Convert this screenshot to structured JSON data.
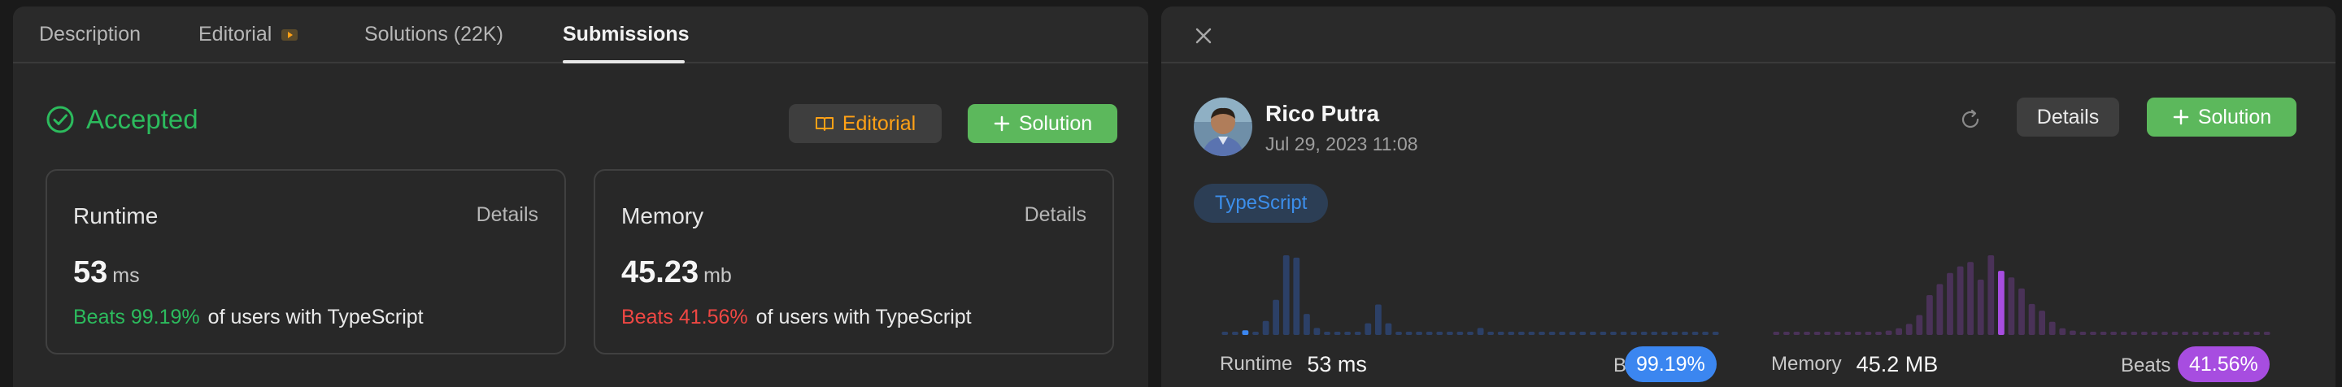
{
  "tabs": [
    {
      "label": "Description",
      "active": false
    },
    {
      "label": "Editorial",
      "active": false
    },
    {
      "label": "Solutions (22K)",
      "active": false
    },
    {
      "label": "Submissions",
      "active": true
    }
  ],
  "result": {
    "status": "Accepted",
    "editorial_button": "Editorial",
    "solution_button": "Solution"
  },
  "runtime_card": {
    "label": "Runtime",
    "details": "Details",
    "value": "53",
    "unit": "ms",
    "beats": "Beats 99.19%",
    "beats_suffix": "of users with TypeScript"
  },
  "memory_card": {
    "label": "Memory",
    "details": "Details",
    "value": "45.23",
    "unit": "mb",
    "beats": "Beats 41.56%",
    "beats_suffix": "of users with TypeScript"
  },
  "submission": {
    "user_name": "Rico Putra",
    "timestamp": "Jul 29, 2023 11:08",
    "details_button": "Details",
    "solution_button": "Solution",
    "language": "TypeScript"
  },
  "runtime_chart": {
    "label": "Runtime",
    "value": "53 ms",
    "beats_label": "Beats",
    "beats": "99.19%",
    "bars": [
      1,
      1,
      2,
      1,
      6,
      15,
      34,
      33,
      9,
      3,
      1,
      1,
      1,
      1,
      5,
      13,
      5,
      1,
      1,
      1,
      1,
      1,
      1,
      1,
      1,
      3,
      1,
      1,
      1,
      1,
      1,
      1,
      1,
      1,
      1,
      1,
      1,
      1,
      1,
      1,
      1,
      1,
      1,
      1,
      1,
      1,
      1,
      1,
      1
    ],
    "highlight_index": 2
  },
  "memory_chart": {
    "label": "Memory",
    "value": "45.2 MB",
    "beats_label": "Beats",
    "beats": "41.56%",
    "bars": [
      1,
      1,
      1,
      1,
      1,
      1,
      1,
      1,
      1,
      1,
      1,
      2,
      3,
      5,
      9,
      18,
      23,
      28,
      31,
      33,
      25,
      36,
      29,
      26,
      21,
      14,
      11,
      6,
      3,
      2,
      1,
      1,
      1,
      1,
      1,
      1,
      1,
      1,
      1,
      1,
      1,
      1,
      1,
      1,
      1,
      1,
      1,
      1,
      1
    ],
    "highlight_index": 22
  },
  "colors": {
    "accepted": "#2cbb5d",
    "editorial": "#ffa116",
    "green_button": "#5cb85c",
    "beats_bad": "#ef4743",
    "runtime_bar": "#2c4067",
    "runtime_highlight": "#3b86f0",
    "memory_bar": "#4a3258",
    "memory_highlight": "#a74de0"
  }
}
